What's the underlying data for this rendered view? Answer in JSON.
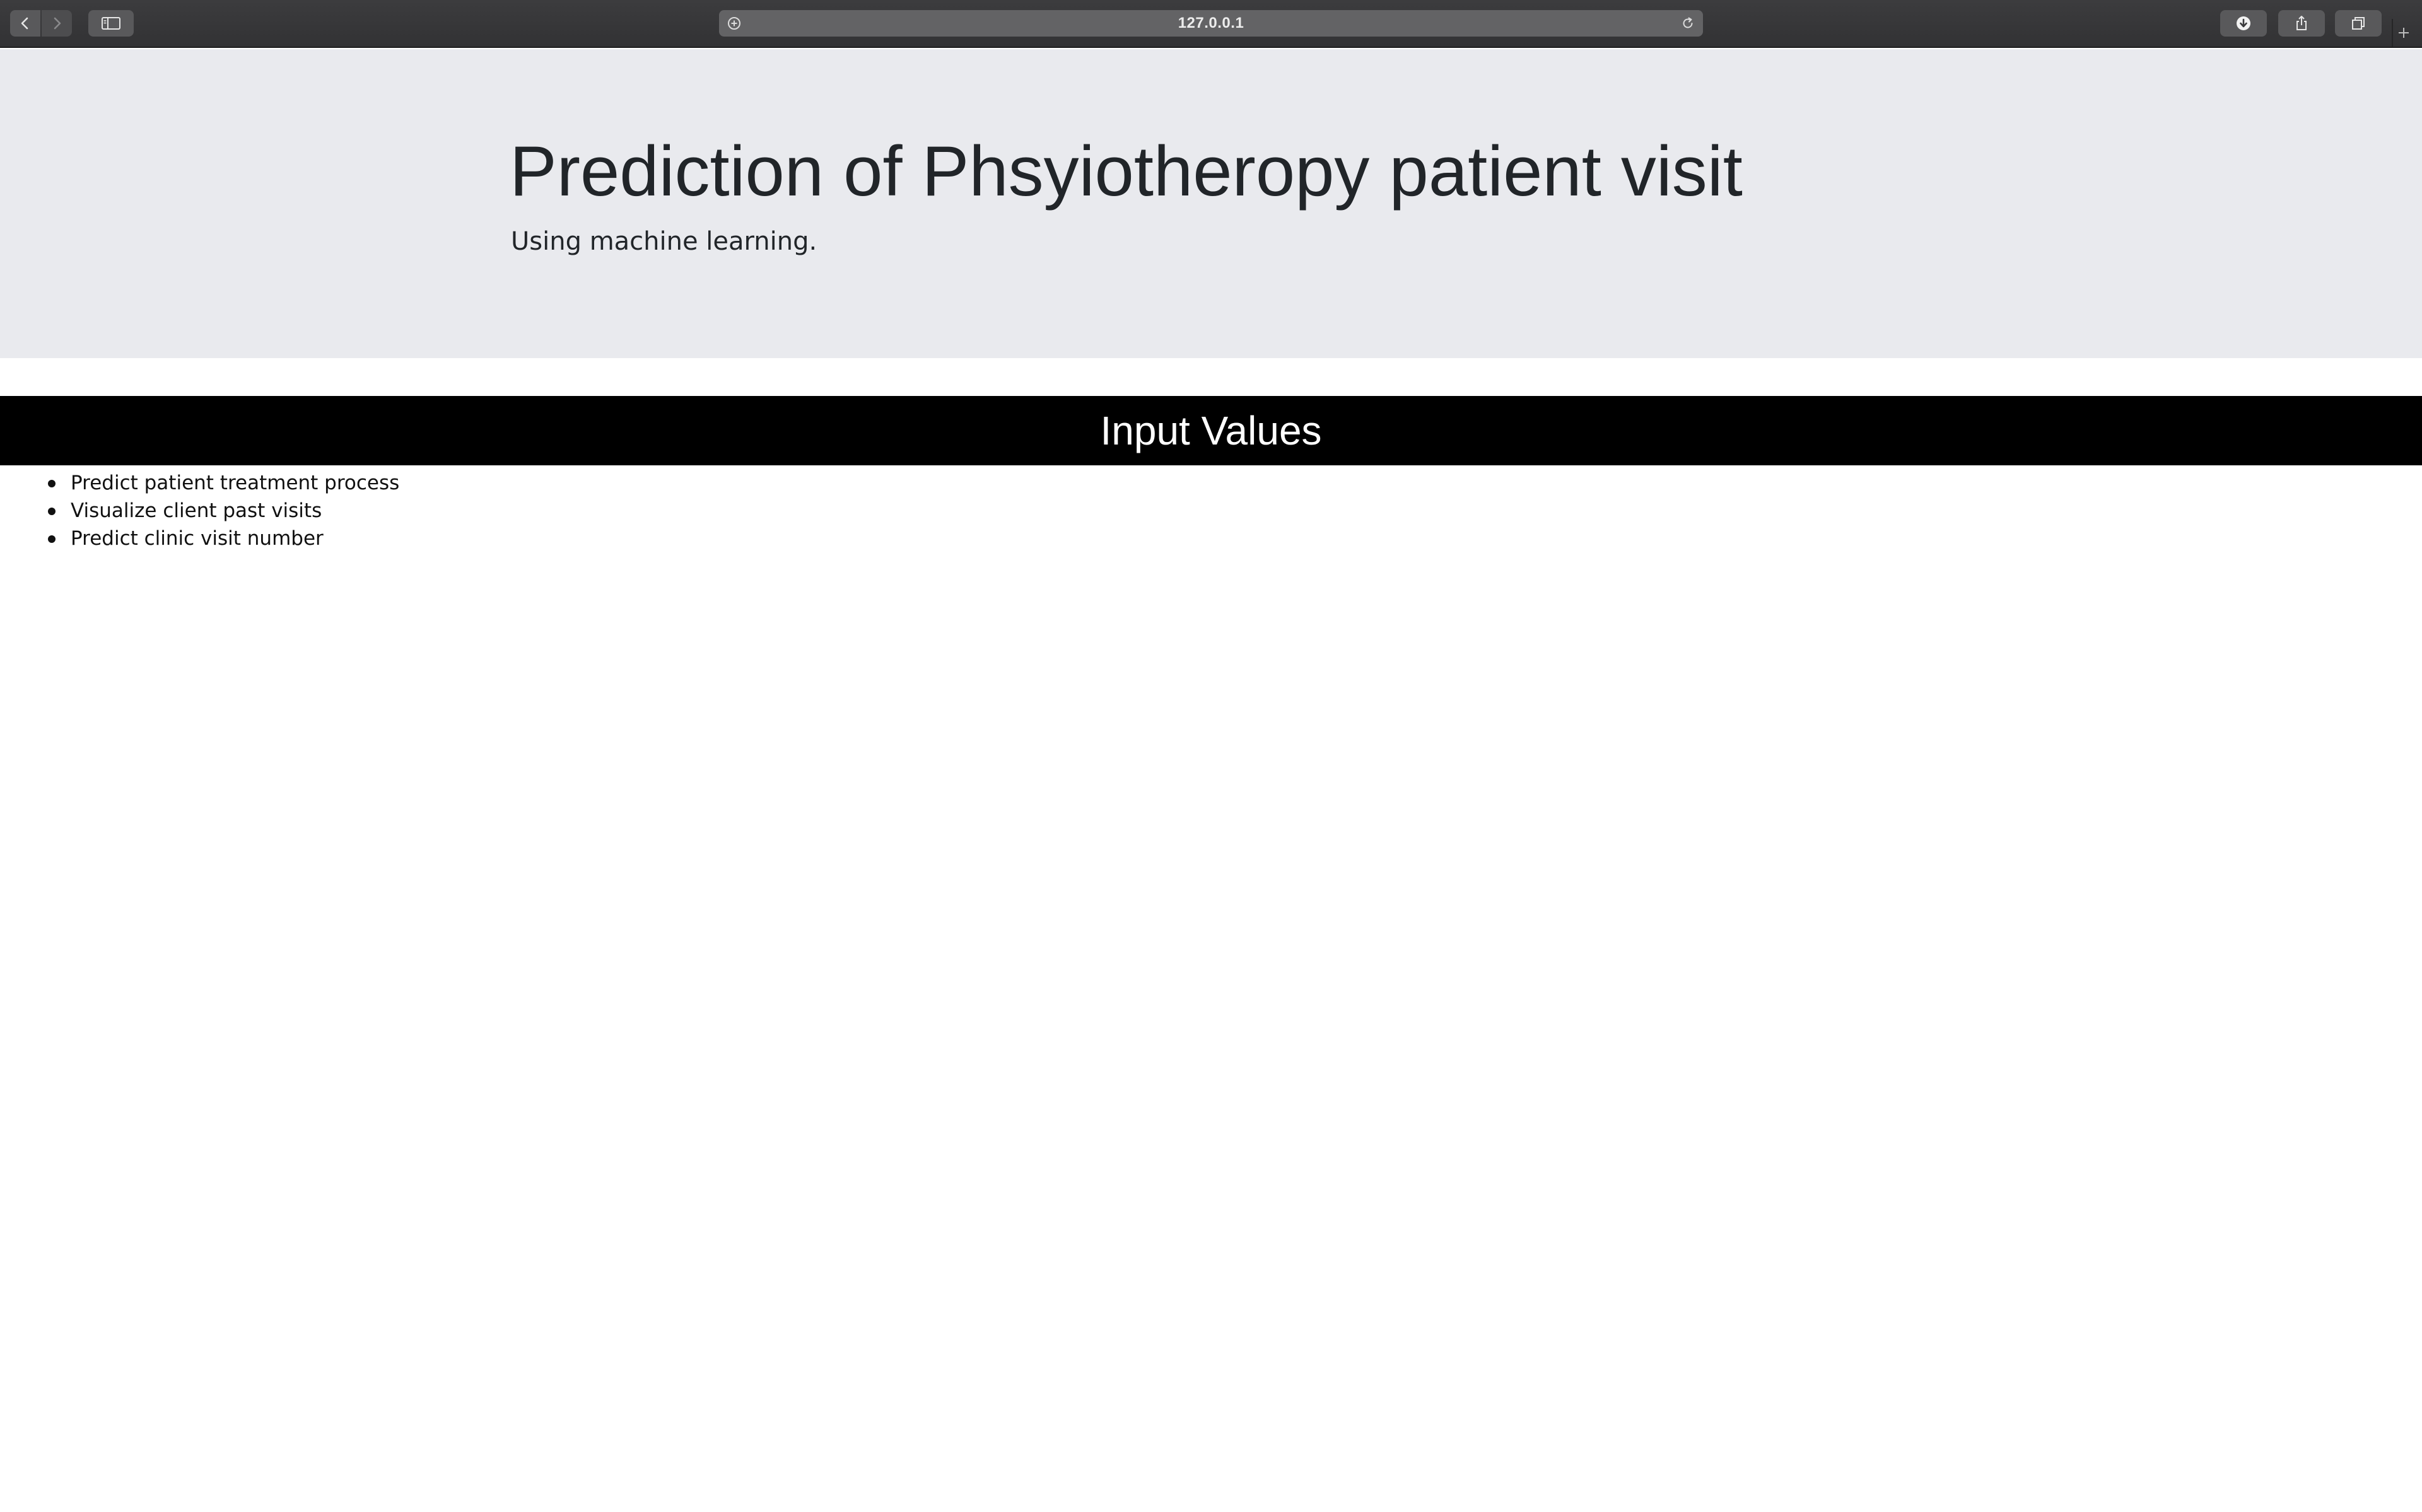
{
  "browser": {
    "url": "127.0.0.1",
    "icons": {
      "back": "chevron-left-icon",
      "forward": "chevron-right-icon",
      "sidebar": "sidebar-icon",
      "site_info": "plus-circle-icon",
      "reload": "reload-icon",
      "downloads": "download-icon",
      "share": "share-icon",
      "tabs": "tabs-icon",
      "new_tab": "plus-icon"
    }
  },
  "page": {
    "hero": {
      "title": "Prediction of Phsyiotheropy patient visit",
      "subtitle": "Using machine learning."
    },
    "section": {
      "title": "Input Values"
    },
    "features": [
      "Predict patient treatment process",
      "Visualize client past visits",
      "Predict clinic visit number"
    ]
  },
  "colors": {
    "hero_background": "#e9eaee",
    "section_bar_background": "#000000",
    "section_bar_text": "#ffffff",
    "toolbar_background": "#3a3a3c"
  }
}
